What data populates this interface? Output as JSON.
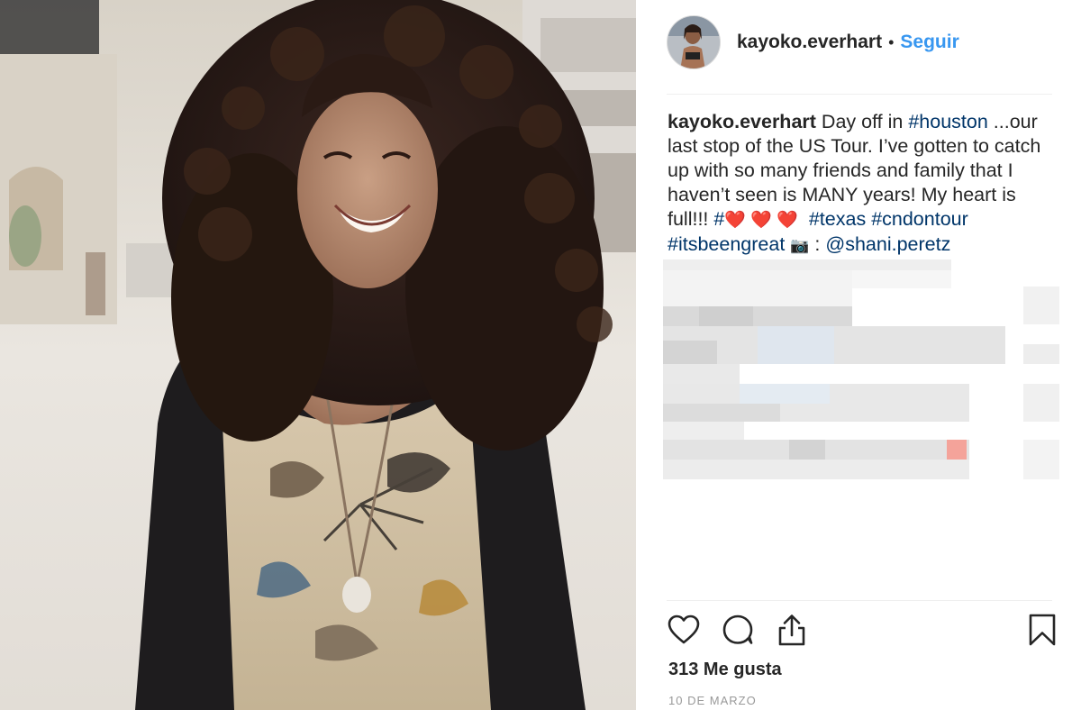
{
  "post": {
    "username": "kayoko.everhart",
    "separator": "•",
    "follow_label": "Seguir",
    "caption": {
      "username": "kayoko.everhart",
      "text_1": " Day off in ",
      "tag_houston": "#houston",
      "text_2": " ...our last stop of the US Tour. I’ve gotten to catch up with so many friends and family that I haven’t seen is MANY years! My heart is full!!! ",
      "hash_prefix": "#",
      "hearts": "❤️ ❤️ ❤️",
      "tag_texas": "#texas",
      "tag_cndontour": "#cndontour",
      "tag_itsbeengreat": "#itsbeengreat",
      "camera": "📷",
      "colon": " : ",
      "mention": "@shani.peretz"
    },
    "likes_label": "313 Me gusta",
    "date_label": "10 DE MARZO"
  },
  "icons": {
    "like": "heart-outline-icon",
    "comment": "comment-bubble-icon",
    "share": "share-upload-icon",
    "save": "bookmark-icon"
  },
  "colors": {
    "link_blue": "#3897f0",
    "hashtag": "#003569",
    "text": "#262626",
    "muted": "#999999"
  }
}
